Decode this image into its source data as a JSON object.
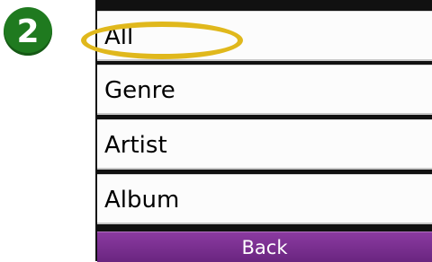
{
  "step_marker": {
    "label": "2",
    "color": "#1f7a1f"
  },
  "menu": {
    "items": [
      {
        "label": "All"
      },
      {
        "label": "Genre"
      },
      {
        "label": "Artist"
      },
      {
        "label": "Album"
      }
    ],
    "back_label": "Back",
    "back_color": "#7a2d90"
  },
  "callout": {
    "color": "#e0b81c",
    "target": "All"
  }
}
